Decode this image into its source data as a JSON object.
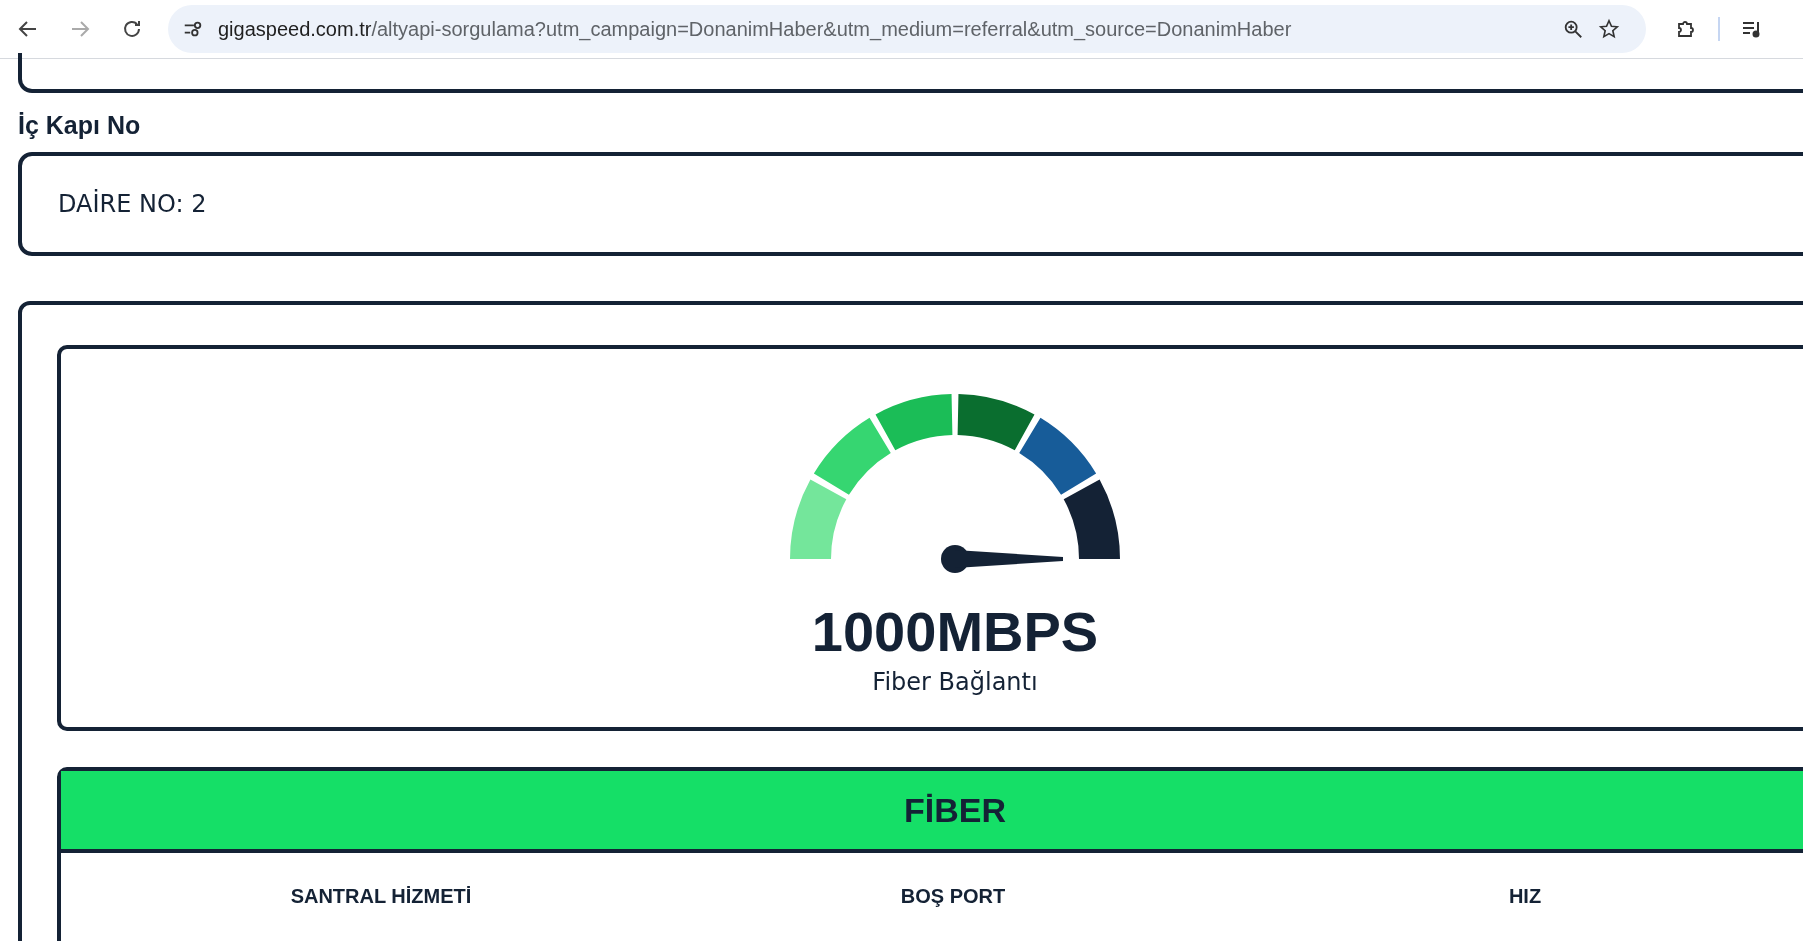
{
  "browser": {
    "url_host": "gigaspeed.com.tr",
    "url_path": "/altyapi-sorgulama?utm_campaign=DonanimHaber&utm_medium=referral&utm_source=DonanimHaber",
    "forward_disabled": true
  },
  "door_field": {
    "label": "İç Kapı No",
    "value": "DAİRE NO: 2"
  },
  "gauge": {
    "segments": [
      {
        "color": "#74e69b"
      },
      {
        "color": "#36d671"
      },
      {
        "color": "#1bbd57"
      },
      {
        "color": "#0a6e2f"
      },
      {
        "color": "#175c99"
      },
      {
        "color": "#142235"
      }
    ],
    "speed": "1000MBPS",
    "caption": "Fiber Bağlantı"
  },
  "table": {
    "title": "FİBER",
    "columns": [
      "SANTRAL HİZMETİ",
      "BOŞ PORT",
      "HIZ"
    ]
  }
}
